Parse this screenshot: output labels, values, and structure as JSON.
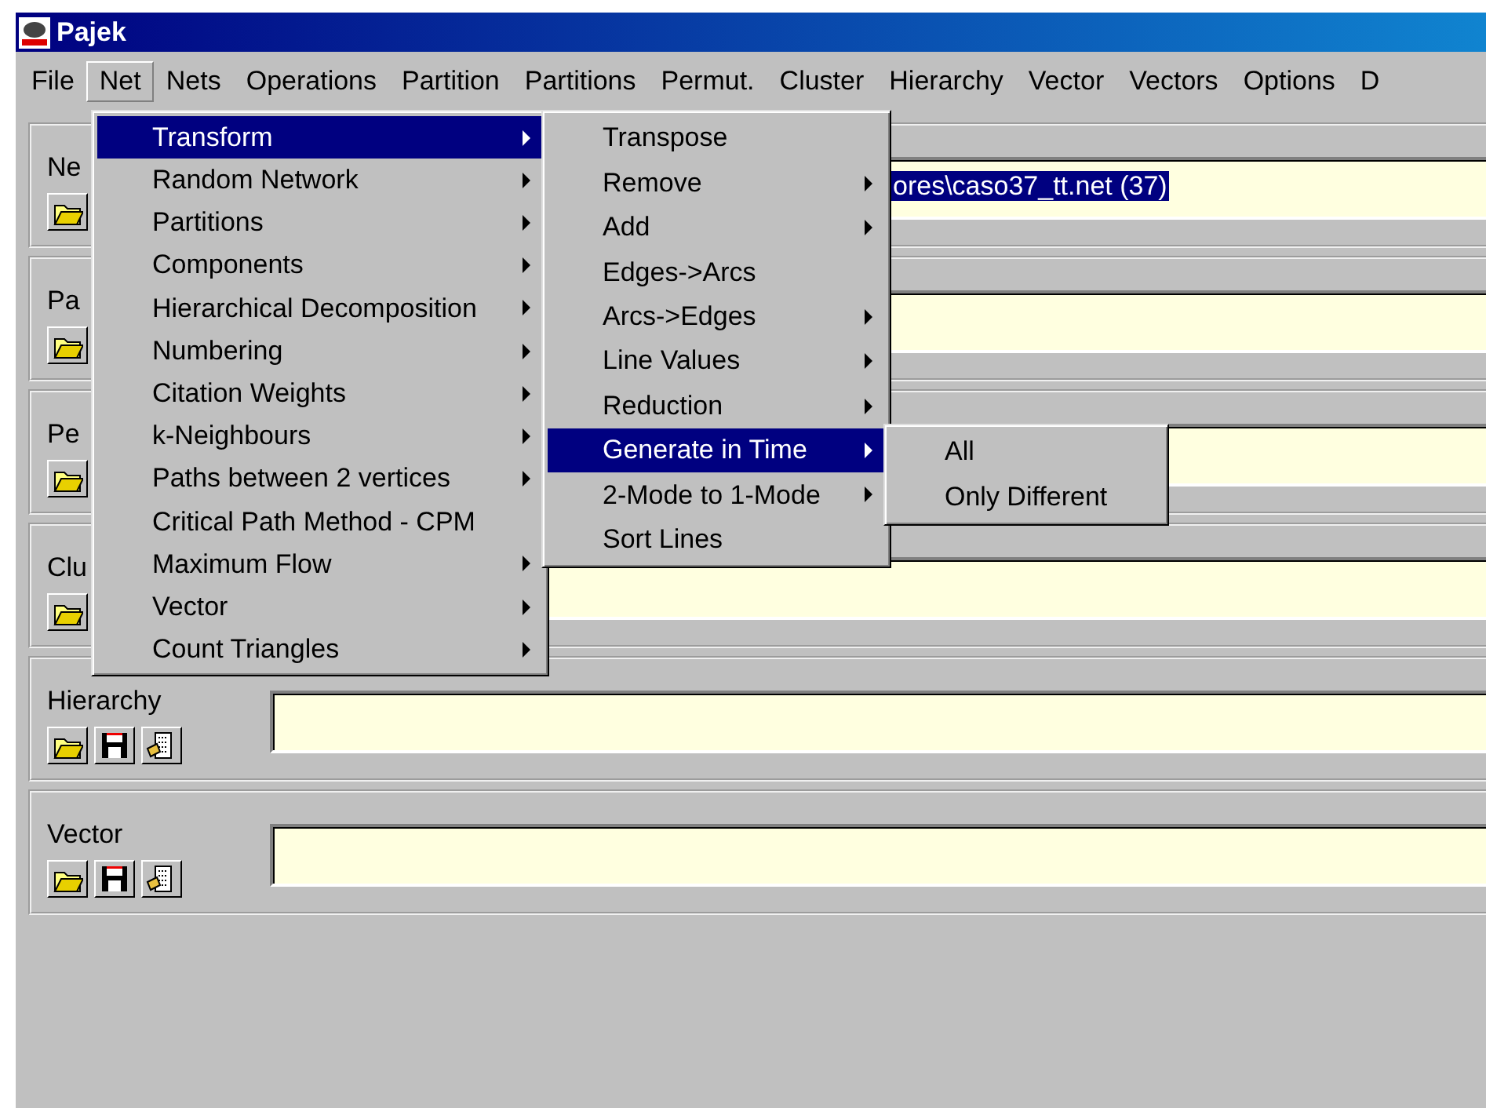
{
  "window": {
    "title": "Pajek"
  },
  "menu_bar": [
    {
      "label": "File",
      "selected": false
    },
    {
      "label": "Net",
      "selected": true
    },
    {
      "label": "Nets",
      "selected": false
    },
    {
      "label": "Operations",
      "selected": false
    },
    {
      "label": "Partition",
      "selected": false
    },
    {
      "label": "Partitions",
      "selected": false
    },
    {
      "label": "Permut.",
      "selected": false
    },
    {
      "label": "Cluster",
      "selected": false
    },
    {
      "label": "Hierarchy",
      "selected": false
    },
    {
      "label": "Vector",
      "selected": false
    },
    {
      "label": "Vectors",
      "selected": false
    },
    {
      "label": "Options",
      "selected": false
    },
    {
      "label": "D",
      "selected": false
    }
  ],
  "panels": [
    {
      "label": "Ne",
      "kind": "covered",
      "field": {
        "value": "ores\\caso37_tt.net (37)",
        "selected": true
      }
    },
    {
      "label": "Pa",
      "kind": "covered"
    },
    {
      "label": "Pe",
      "kind": "covered"
    },
    {
      "label": "Clu",
      "kind": "covered"
    },
    {
      "label": "Hierarchy",
      "kind": "full"
    },
    {
      "label": "Vector",
      "kind": "full"
    }
  ],
  "menus": [
    {
      "items": [
        {
          "label": "Transform",
          "submenu": true,
          "selected": true
        },
        {
          "label": "Random Network",
          "submenu": true,
          "selected": false
        },
        {
          "label": "Partitions",
          "submenu": true,
          "selected": false
        },
        {
          "label": "Components",
          "submenu": true,
          "selected": false
        },
        {
          "label": "Hierarchical Decomposition",
          "submenu": true,
          "selected": false
        },
        {
          "label": "Numbering",
          "submenu": true,
          "selected": false
        },
        {
          "label": "Citation Weights",
          "submenu": true,
          "selected": false
        },
        {
          "label": "k-Neighbours",
          "submenu": true,
          "selected": false
        },
        {
          "label": "Paths between 2 vertices",
          "submenu": true,
          "selected": false
        },
        {
          "label": "Critical Path Method - CPM",
          "submenu": false,
          "selected": false
        },
        {
          "label": "Maximum Flow",
          "submenu": true,
          "selected": false
        },
        {
          "label": "Vector",
          "submenu": true,
          "selected": false
        },
        {
          "label": "Count Triangles",
          "submenu": true,
          "selected": false
        }
      ]
    },
    {
      "items": [
        {
          "label": "Transpose",
          "submenu": false,
          "selected": false
        },
        {
          "label": "Remove",
          "submenu": true,
          "selected": false
        },
        {
          "label": "Add",
          "submenu": true,
          "selected": false
        },
        {
          "label": "Edges->Arcs",
          "submenu": false,
          "selected": false
        },
        {
          "label": "Arcs->Edges",
          "submenu": true,
          "selected": false
        },
        {
          "label": "Line Values",
          "submenu": true,
          "selected": false
        },
        {
          "label": "Reduction",
          "submenu": true,
          "selected": false
        },
        {
          "label": "Generate in Time",
          "submenu": true,
          "selected": true
        },
        {
          "label": "2-Mode to 1-Mode",
          "submenu": true,
          "selected": false
        },
        {
          "label": "Sort Lines",
          "submenu": false,
          "selected": false
        }
      ]
    },
    {
      "items": [
        {
          "label": "All",
          "submenu": false,
          "selected": false
        },
        {
          "label": "Only Different",
          "submenu": false,
          "selected": false
        }
      ]
    }
  ]
}
